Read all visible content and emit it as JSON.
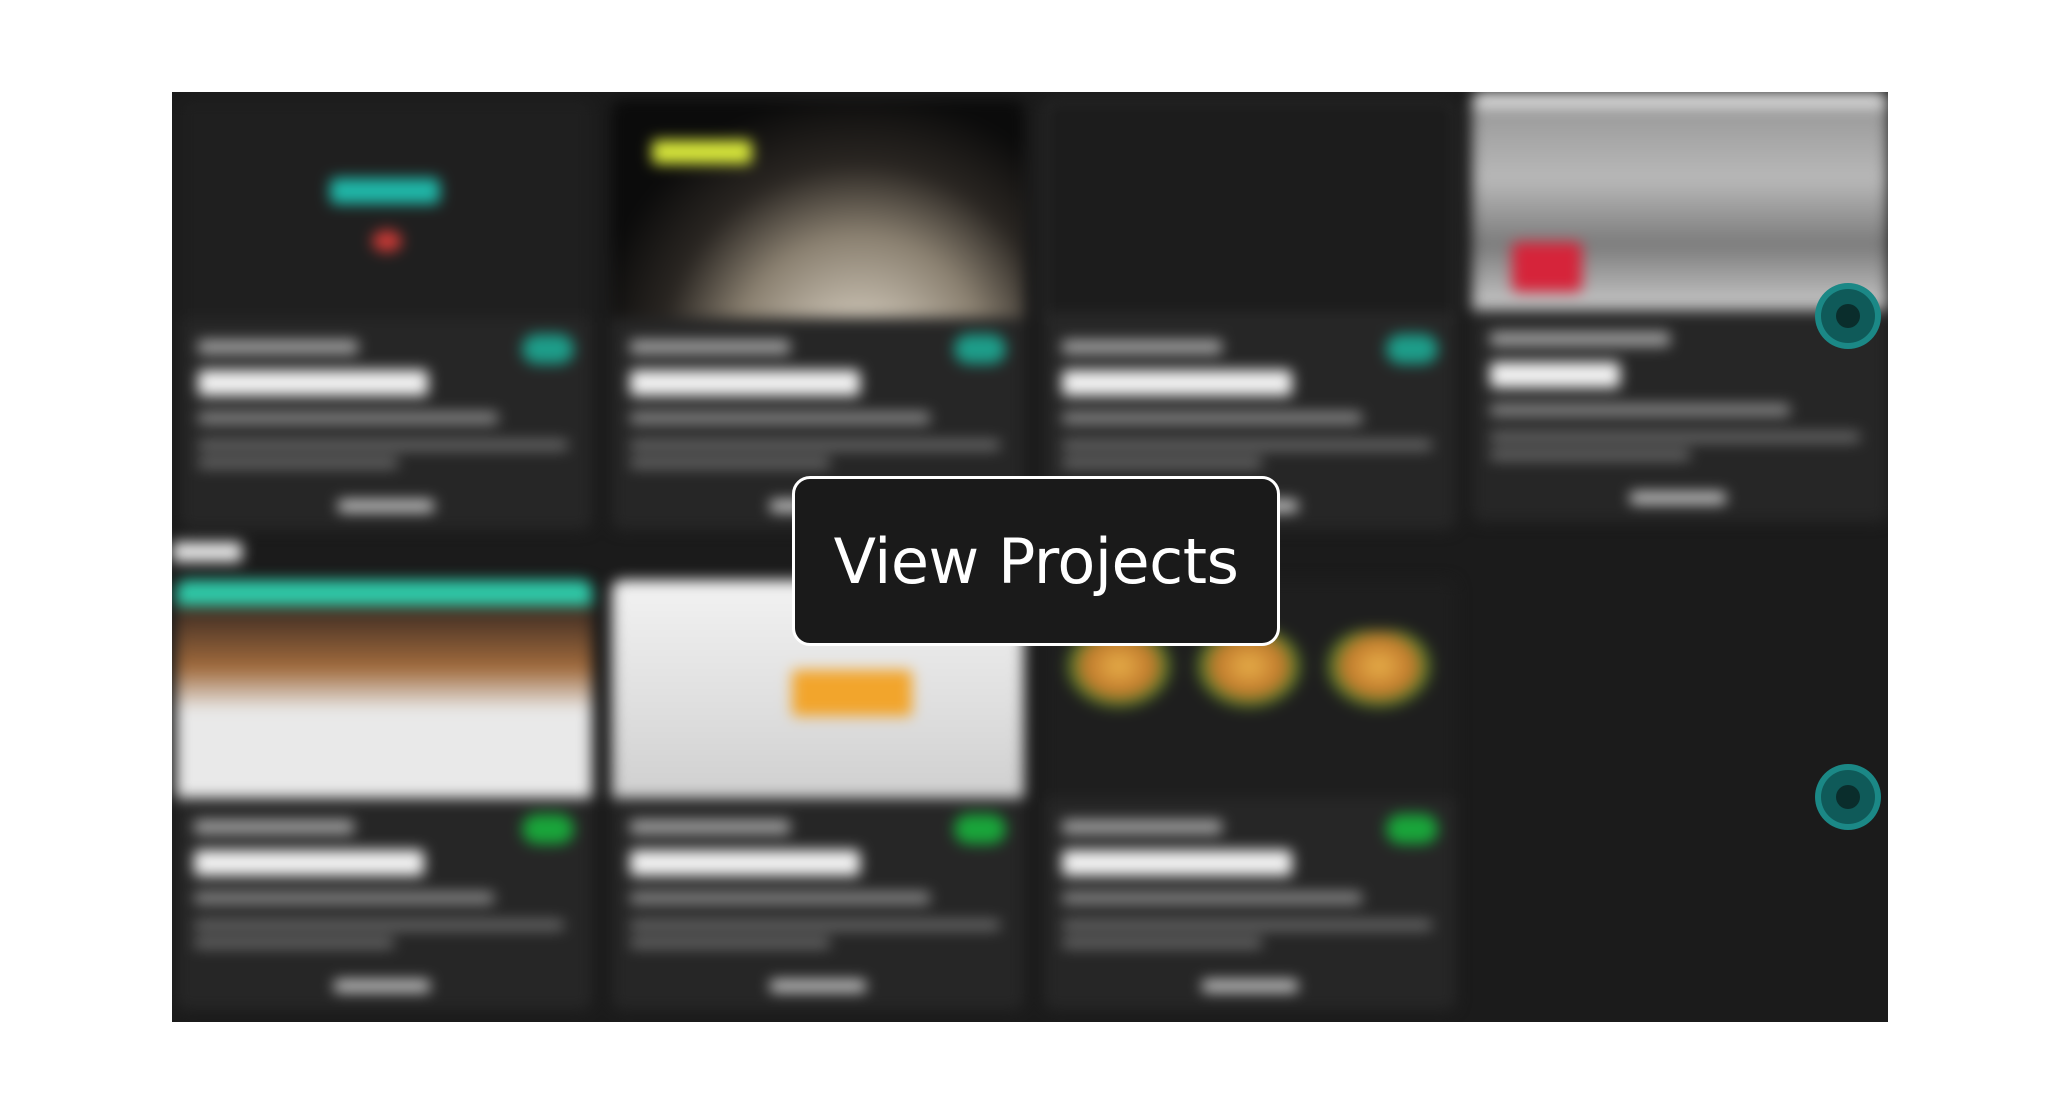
{
  "overlay": {
    "label": "View Projects"
  },
  "projects": [
    {
      "thumbnail": "logo-dark",
      "badge_color": "#1d9e8a"
    },
    {
      "thumbnail": "dark-globe",
      "badge_color": "#1d9e8a"
    },
    {
      "thumbnail": "empty-frame",
      "badge_color": "#1d9e8a"
    },
    {
      "thumbnail": "delivery-van",
      "badge_color": "#1d9e8a"
    },
    {
      "thumbnail": "web-page-teal-header",
      "badge_color": "#19a63a"
    },
    {
      "thumbnail": "light-web-page",
      "badge_color": "#19a63a"
    },
    {
      "thumbnail": "burger-menu-app",
      "badge_color": "#19a63a"
    }
  ],
  "theme": {
    "background": "#1b1b1b",
    "card": "#262626",
    "accent": "#1b8886",
    "button_border": "#ffffff"
  }
}
